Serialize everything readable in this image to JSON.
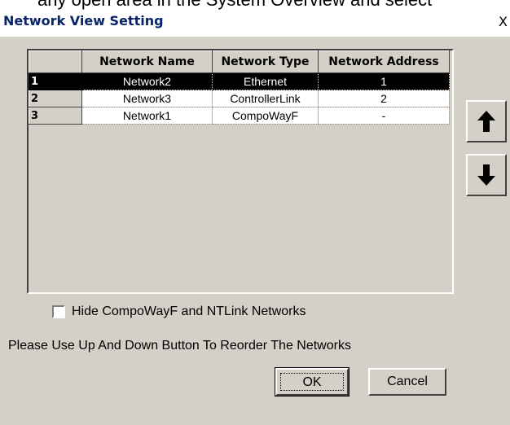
{
  "background_text": "any open area in the System Overview and select",
  "dialog": {
    "title": "Network View Setting",
    "close_glyph": "X"
  },
  "grid": {
    "columns": [
      "",
      "Network Name",
      "Network Type",
      "Network Address"
    ],
    "rows": [
      {
        "index": "1",
        "name": "Network2",
        "type": "Ethernet",
        "address": "1",
        "selected": true
      },
      {
        "index": "2",
        "name": "Network3",
        "type": "ControllerLink",
        "address": "2",
        "selected": false
      },
      {
        "index": "3",
        "name": "Network1",
        "type": "CompoWayF",
        "address": "-",
        "selected": false
      }
    ]
  },
  "move_up": {
    "icon": "arrow-up-icon"
  },
  "move_down": {
    "icon": "arrow-down-icon"
  },
  "hide_checkbox": {
    "label": "Hide CompoWayF and NTLink Networks",
    "checked": false
  },
  "hint_text": "Please Use Up And Down Button To Reorder The Networks",
  "buttons": {
    "ok": "OK",
    "cancel": "Cancel"
  }
}
